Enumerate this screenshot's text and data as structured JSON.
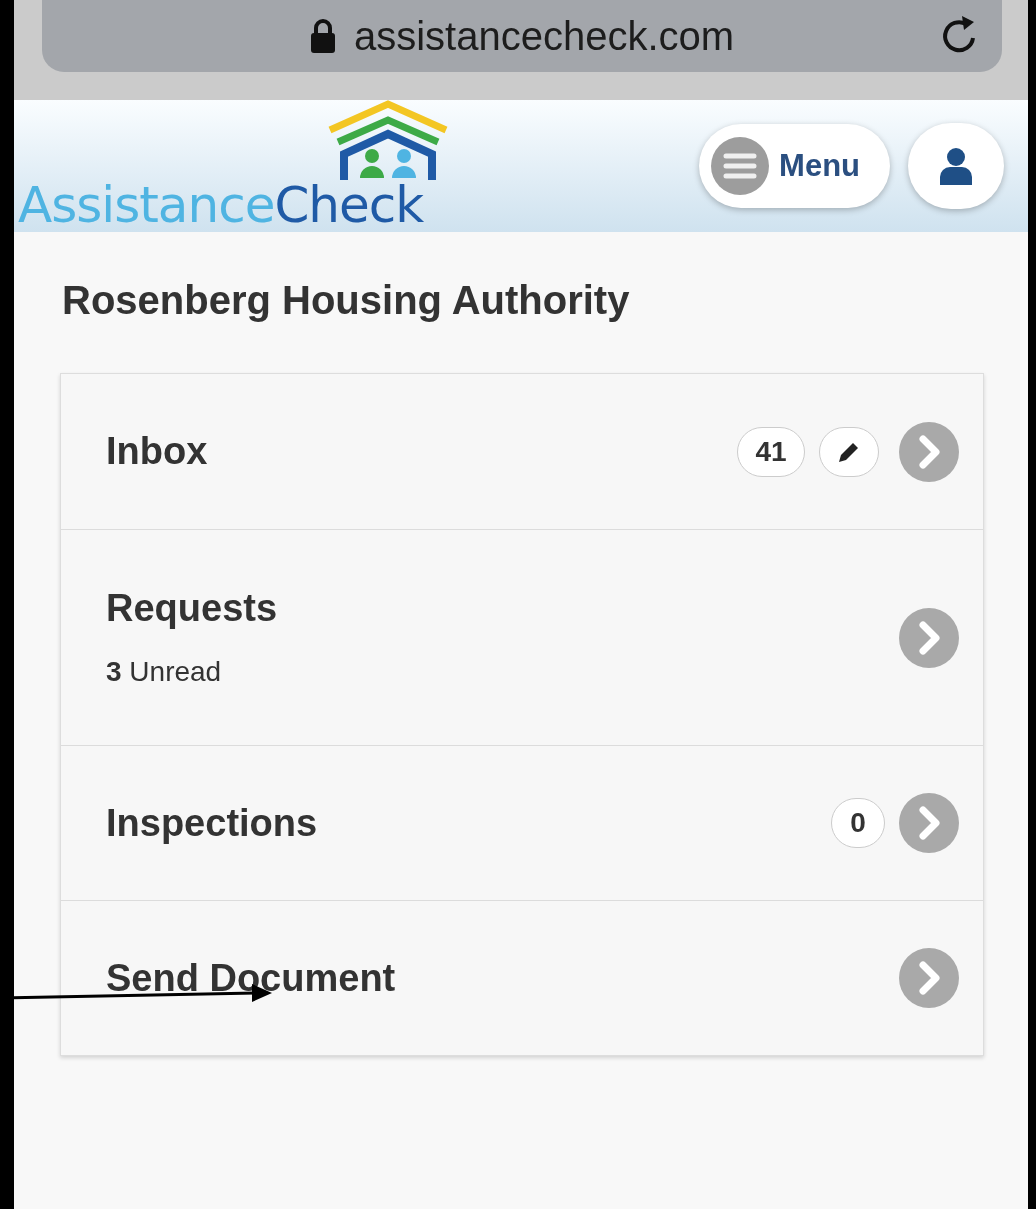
{
  "browser": {
    "address": "assistancecheck.com"
  },
  "header": {
    "logo": {
      "first": "Assistance",
      "second": "Check"
    },
    "menu_button": "Menu"
  },
  "page_title": "Rosenberg Housing Authority",
  "items": [
    {
      "label": "Inbox",
      "badges": [
        {
          "kind": "count",
          "text": "41"
        },
        {
          "kind": "edit"
        }
      ]
    },
    {
      "label": "Requests",
      "subtitle": "**3** Unread"
    },
    {
      "label": "Inspections",
      "badges": [
        {
          "kind": "count",
          "text": "0"
        }
      ]
    },
    {
      "label": "Send Document"
    }
  ],
  "annotation": {
    "kind": "arrow"
  }
}
